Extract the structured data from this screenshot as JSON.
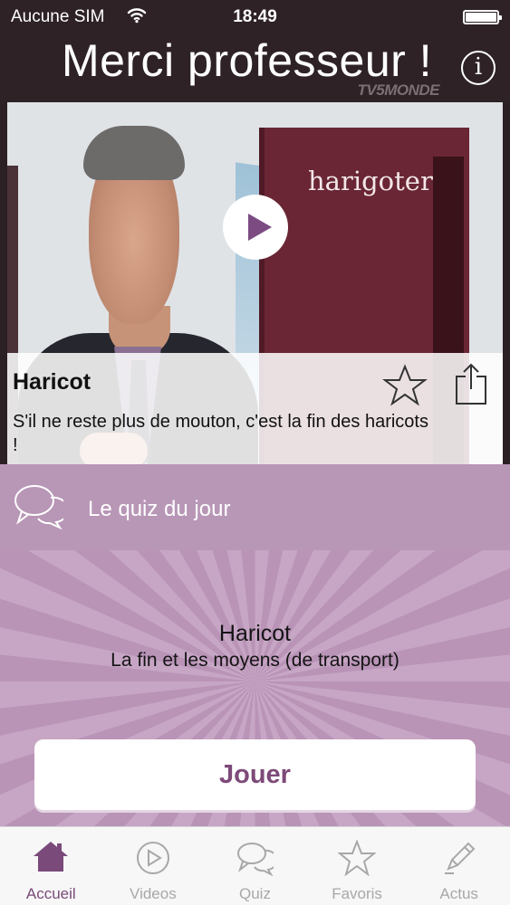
{
  "status_bar": {
    "carrier": "Aucune SIM",
    "time": "18:49"
  },
  "header": {
    "title": "Merci professeur !",
    "brand": "TV5MONDE"
  },
  "video": {
    "word": "harigoter",
    "title": "Haricot",
    "description": "S'il ne reste plus de mouton, c'est la fin des haricots !"
  },
  "quiz": {
    "bar_label": "Le quiz du jour",
    "title": "Haricot",
    "subtitle": "La fin et les moyens (de transport)",
    "play_label": "Jouer"
  },
  "tabs": [
    {
      "label": "Accueil",
      "icon": "home-icon",
      "active": true
    },
    {
      "label": "Videos",
      "icon": "play-circle-icon",
      "active": false
    },
    {
      "label": "Quiz",
      "icon": "speech-bubbles-icon",
      "active": false
    },
    {
      "label": "Favoris",
      "icon": "star-icon",
      "active": false
    },
    {
      "label": "Actus",
      "icon": "pencil-icon",
      "active": false
    }
  ],
  "colors": {
    "header_bg": "#2e2226",
    "accent": "#7a4a7a",
    "quiz_bar": "#b896b6"
  }
}
